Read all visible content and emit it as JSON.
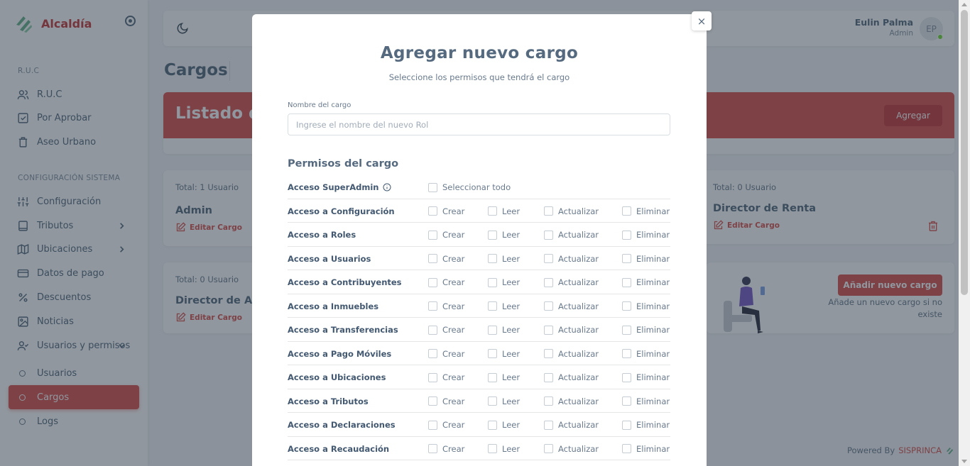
{
  "app": {
    "brand": "Alcaldía"
  },
  "sidebar": {
    "section_ruc": "R.U.C",
    "section_config": "CONFIGURACIÓN SISTEMA",
    "items": [
      {
        "label": "R.U.C",
        "icon": "users-icon"
      },
      {
        "label": "Por Aprobar",
        "icon": "checkbox-icon"
      },
      {
        "label": "Aseo Urbano",
        "icon": "trash-icon"
      },
      {
        "label": "Configuración",
        "icon": "sliders-icon"
      },
      {
        "label": "Tributos",
        "icon": "book-icon"
      },
      {
        "label": "Ubicaciones",
        "icon": "map-icon"
      },
      {
        "label": "Datos de pago",
        "icon": "credit-card-icon"
      },
      {
        "label": "Descuentos",
        "icon": "percent-icon"
      },
      {
        "label": "Noticias",
        "icon": "image-icon"
      },
      {
        "label": "Usuarios y permisos",
        "icon": "user-check-icon"
      },
      {
        "label": "Usuarios"
      },
      {
        "label": "Cargos"
      },
      {
        "label": "Logs"
      }
    ]
  },
  "navbar": {
    "user_name": "Eulin Palma",
    "user_role": "Admin",
    "avatar_initials": "EP"
  },
  "page": {
    "title": "Cargos",
    "banner_title": "Listado de",
    "banner_button": "Agregar",
    "cards": [
      {
        "total": "Total: 1 Usuario",
        "role": "Admin",
        "edit": "Editar Cargo"
      },
      {
        "total": "Total: 0 Usuario",
        "role": "Director de Renta",
        "edit": "Editar Cargo"
      },
      {
        "total": "Total: 0 Usuario",
        "role": "Director de Ad",
        "edit": "Editar Cargo"
      }
    ],
    "add_new_button": "Añadir nuevo cargo",
    "add_new_desc": "Añade un nuevo cargo si no existe",
    "powered_by": "Powered By",
    "powered_brand": "SISPRINCA"
  },
  "modal": {
    "close": "×",
    "title": "Agregar nuevo cargo",
    "subtitle": "Seleccione los permisos que tendrá el cargo",
    "name_label": "Nombre del cargo",
    "name_placeholder": "Ingrese el nombre del nuevo Rol",
    "permissions_title": "Permisos del cargo",
    "superadmin_label": "Acceso SuperAdmin",
    "select_all": "Seleccionar todo",
    "actions": {
      "create": "Crear",
      "read": "Leer",
      "update": "Actualizar",
      "delete": "Eliminar"
    },
    "permissions": [
      "Acceso a Configuración",
      "Acceso a Roles",
      "Acceso a Usuarios",
      "Acceso a Contribuyentes",
      "Acceso a Inmuebles",
      "Acceso a Transferencias",
      "Acceso a Pago Móviles",
      "Acceso a Ubicaciones",
      "Acceso a Tributos",
      "Acceso a Declaraciones",
      "Acceso a Recaudación"
    ]
  },
  "colors": {
    "accent": "#d9534f",
    "brand": "#c93a3a",
    "overlay": "#22303e"
  }
}
